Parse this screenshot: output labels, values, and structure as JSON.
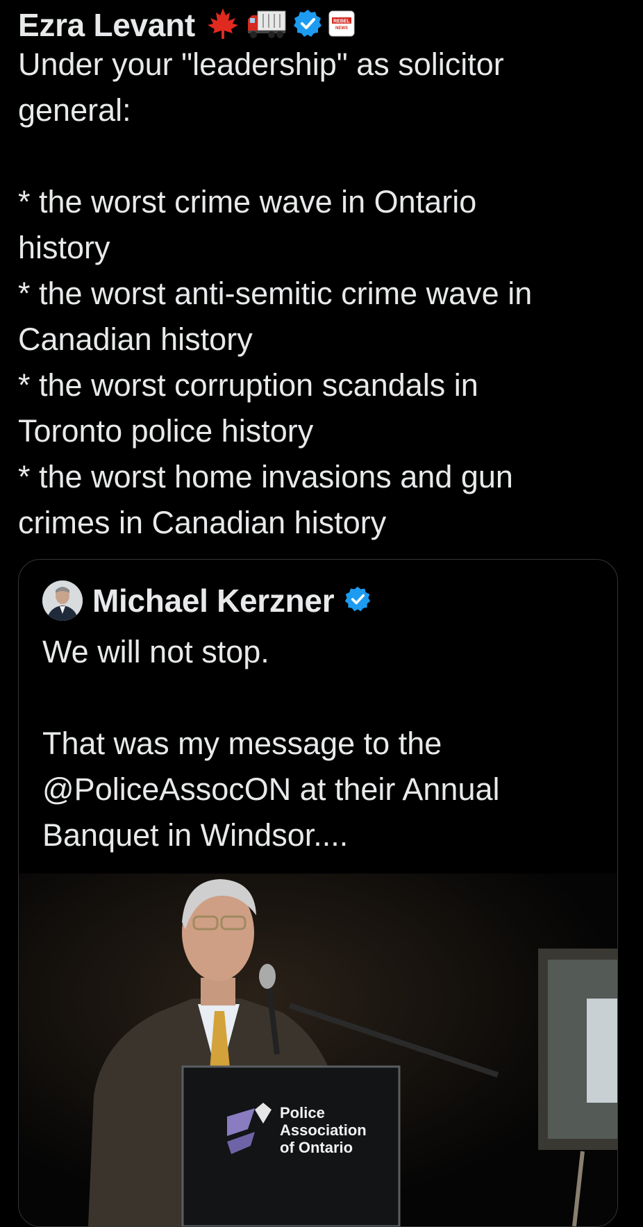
{
  "tweet": {
    "author_name": "Ezra Levant",
    "badges": {
      "leaf": "maple-leaf-icon",
      "truck": "truck-icon",
      "verified": "verified-badge-icon",
      "affiliate": "rebel-news-logo"
    },
    "affiliate_logo_text": [
      "REBEL",
      "NEWS"
    ],
    "text_lines": [
      "Under your \"leadership\" as solicitor",
      "general:",
      "",
      "* the worst crime wave in Ontario",
      "history",
      "* the worst anti-semitic crime wave in",
      "Canadian history",
      "* the worst corruption scandals in",
      "Toronto police history",
      "* the worst home invasions and gun",
      "crimes in Canadian history"
    ]
  },
  "quote": {
    "author_name": "Michael Kerzner",
    "verified_icon": "verified-badge-icon",
    "text_lines": [
      "We will not stop.",
      "",
      "That was my message to the",
      "@PoliceAssocON at their Annual",
      "Banquet in Windsor...."
    ],
    "media": {
      "podium_sign": [
        "Police",
        "Association",
        "of Ontario"
      ]
    }
  },
  "colors": {
    "background": "#000000",
    "text": "#e7e9ea",
    "verified_blue": "#1d9bf0",
    "card_border": "#333639"
  }
}
